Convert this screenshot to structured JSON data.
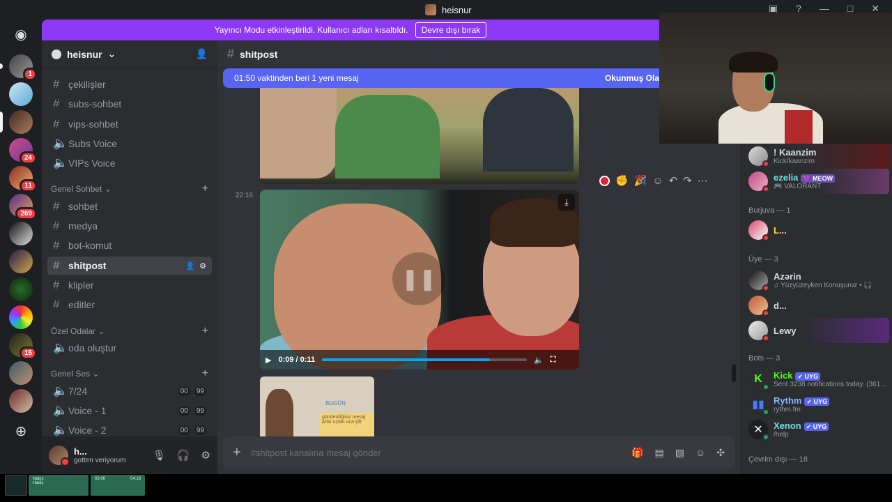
{
  "window": {
    "title": "heisnur",
    "controls": [
      "—",
      "□",
      "✕"
    ]
  },
  "banner": {
    "text": "Yayıncı Modu etkinleştirildi. Kullanıcı adları kısaltıldı.",
    "button": "Devre dışı bırak"
  },
  "guilds": {
    "badges": [
      "1",
      "24",
      "11",
      "269",
      "15"
    ]
  },
  "server": {
    "name": "heisnur"
  },
  "channels": {
    "top": [
      {
        "icon": "hash",
        "label": "çekilişler"
      },
      {
        "icon": "hash",
        "label": "subs-sohbet"
      },
      {
        "icon": "hash",
        "label": "vips-sohbet"
      },
      {
        "icon": "voice",
        "label": "Subs Voice"
      },
      {
        "icon": "voice",
        "label": "VIPs Voice"
      }
    ],
    "cat_general_chat": "Genel Sohbet",
    "general": [
      {
        "label": "sohbet"
      },
      {
        "label": "medya"
      },
      {
        "label": "bot-komut"
      },
      {
        "label": "shitpost"
      },
      {
        "label": "klipler"
      },
      {
        "label": "editler"
      }
    ],
    "cat_private": "Özel Odalar",
    "private_room": "oda oluştur",
    "cat_general_voice": "Genel Ses",
    "voice": [
      {
        "label": "7/24",
        "a": "00",
        "b": "99"
      },
      {
        "label": "Voice - 1",
        "a": "00",
        "b": "99"
      },
      {
        "label": "Voice - 2",
        "a": "00",
        "b": "99"
      }
    ]
  },
  "user": {
    "name": "h...",
    "status": "gotten veriyorum"
  },
  "main": {
    "channel": "shitpost",
    "new_messages": "01:50 vaktinden beri 1 yeni mesaj",
    "mark_read": "Okunmuş Ola",
    "timestamp": "22:16",
    "video": {
      "time": "0:09 / 0:11",
      "progress": 0.82
    },
    "thumb_text": {
      "bugun": "BUGÜN",
      "note": "gönderdiğiniz mesaj artık uçtan uca şifr"
    },
    "composer_placeholder": "#shitpost kanalına mesaj gönder"
  },
  "members": {
    "top": [
      {
        "name": "! Kaanzim",
        "sub": "Kick/kaanzim",
        "color": "#f2f3f5"
      },
      {
        "name": "ezelia",
        "tag": "💜 MEOW",
        "sub": "🎮 VALORANT",
        "color": "#6ee0e8"
      }
    ],
    "grp_burjuva": "Burjuva — 1",
    "burjuva": [
      {
        "name": "L...",
        "color": "#f0e04a"
      }
    ],
    "grp_uye": "Üye — 3",
    "uye": [
      {
        "name": "Azərin",
        "sub": "♫ Yüzyüzeyken Konuşuruz • 🎧",
        "color": "#dbdee1"
      },
      {
        "name": "d...",
        "color": "#dbdee1"
      },
      {
        "name": "Lewy",
        "color": "#dbdee1"
      }
    ],
    "grp_bots": "Bots — 3",
    "bots": [
      {
        "name": "Kick",
        "tag": "✔ UYG",
        "sub": "Sent 3238 notifications today. (361...",
        "color": "#53fc18"
      },
      {
        "name": "Rythm",
        "tag": "✔ UYG",
        "sub": "rythm.fm",
        "color": "#8ab4ff"
      },
      {
        "name": "Xenon",
        "tag": "✔ UYG",
        "sub": "/help",
        "color": "#6ee0e8"
      }
    ],
    "grp_offline": "Çevrim dışı — 18"
  },
  "taskbar": {
    "task1_title": "Nabız",
    "task1_sub": "Hadiş",
    "task2_a": "03:06",
    "task2_b": "04:18"
  }
}
